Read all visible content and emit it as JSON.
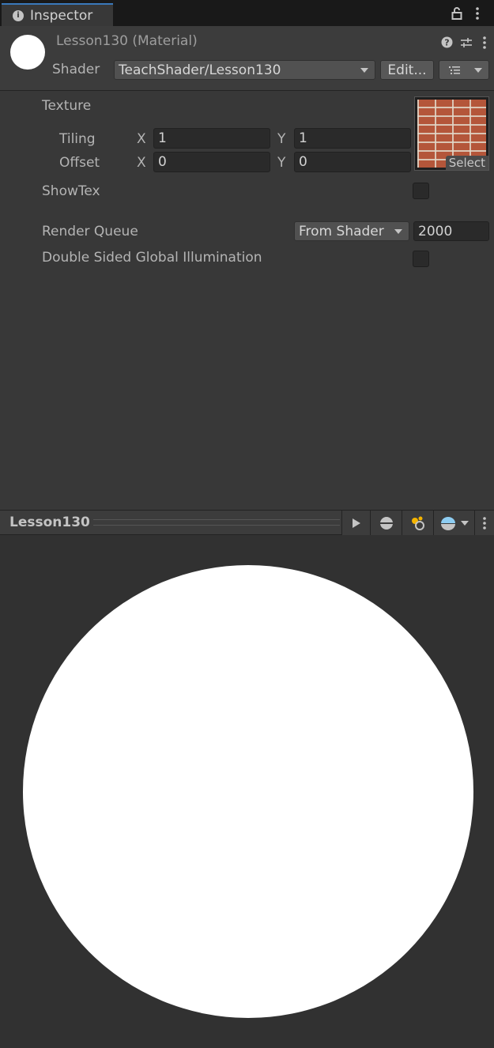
{
  "tab": {
    "title": "Inspector",
    "icon": "info-icon"
  },
  "tabbar_icons": [
    "lock-icon",
    "kebab-menu-icon"
  ],
  "header": {
    "title": "Lesson130 (Material)",
    "shader_label": "Shader",
    "shader_value": "TeachShader/Lesson130",
    "edit_button": "Edit...",
    "icons": [
      "help-icon",
      "preset-settings-icon",
      "kebab-menu-icon",
      "list-icon"
    ]
  },
  "texture": {
    "label": "Texture",
    "tiling_label": "Tiling",
    "offset_label": "Offset",
    "x_label": "X",
    "y_label": "Y",
    "tiling_x": "1",
    "tiling_y": "1",
    "offset_x": "0",
    "offset_y": "0",
    "select_label": "Select"
  },
  "showtex": {
    "label": "ShowTex",
    "checked": false
  },
  "render_queue": {
    "label": "Render Queue",
    "mode": "From Shader",
    "value": "2000"
  },
  "double_sided": {
    "label": "Double Sided Global Illumination",
    "checked": false
  },
  "preview": {
    "title": "Lesson130",
    "icons": [
      "play-icon",
      "sphere-mesh-icon",
      "lights-icon",
      "skybox-icon",
      "kebab-menu-icon"
    ]
  }
}
